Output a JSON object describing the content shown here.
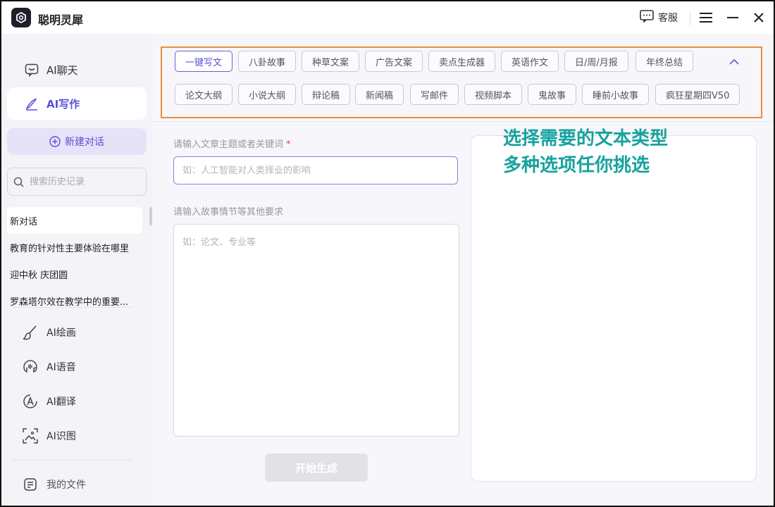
{
  "app": {
    "title": "聪明灵犀"
  },
  "titlebar": {
    "service_label": "客服"
  },
  "sidebar": {
    "nav": [
      {
        "label": "AI聊天",
        "icon": "chat-icon",
        "active": false
      },
      {
        "label": "AI写作",
        "icon": "pen-icon",
        "active": true
      }
    ],
    "new_chat_label": "新建对话",
    "search_placeholder": "搜索历史记录",
    "history": [
      "新对话",
      "教育的针对性主要体验在哪里",
      "迎中秋 庆团圆",
      "罗森塔尔效在教学中的重要..."
    ],
    "tools": [
      {
        "label": "AI绘画",
        "icon": "brush-icon"
      },
      {
        "label": "AI语音",
        "icon": "voice-icon"
      },
      {
        "label": "AI翻译",
        "icon": "translate-icon"
      },
      {
        "label": "AI识图",
        "icon": "image-scan-icon"
      }
    ],
    "my_files_label": "我的文件"
  },
  "main": {
    "tags_row1": [
      "一键写文",
      "八卦故事",
      "种草文案",
      "广告文案",
      "卖点生成器",
      "英语作文",
      "日/周/月报",
      "年终总结"
    ],
    "tags_row2": [
      "论文大纲",
      "小说大纲",
      "辩论稿",
      "新闻稿",
      "写邮件",
      "视频脚本",
      "鬼故事",
      "睡前小故事",
      "疯狂星期四V50"
    ],
    "active_tag": "一键写文",
    "topic_label": "请输入文章主题或者关键词",
    "topic_required_mark": "*",
    "topic_placeholder": "如：人工智能对人类择业的影响",
    "extra_label": "请输入故事情节等其他要求",
    "extra_placeholder": "如：论文、专业等",
    "generate_label": "开始生成"
  },
  "annotation": {
    "line1": "选择需要的文本类型",
    "line2": "多种选项任你挑选"
  },
  "colors": {
    "accent": "#5b50d6",
    "highlight_border": "#ee8c3a",
    "annotation_text": "#16a39e"
  }
}
